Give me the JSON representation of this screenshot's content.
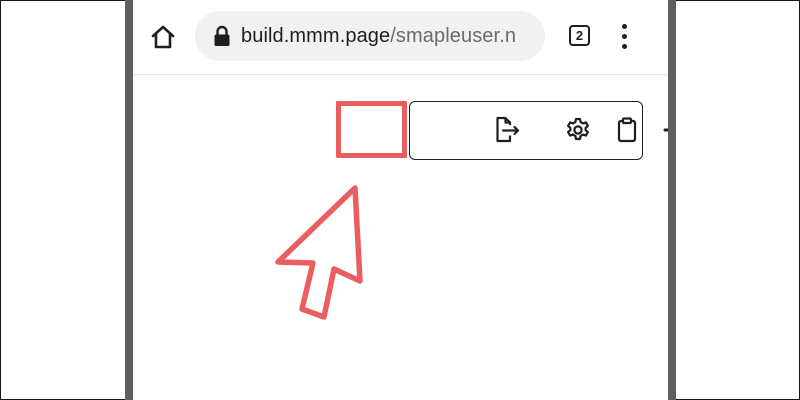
{
  "browser": {
    "url_host": "build.mmm.page",
    "url_path": "/smapleuser.n",
    "tab_count": "2"
  },
  "icons": {
    "home": "home-icon",
    "lock": "lock-icon",
    "menu": "more-vert-icon",
    "export": "file-export-icon",
    "settings": "gear-icon",
    "clipboard": "clipboard-icon",
    "add": "plus-icon",
    "logout": "logout-icon"
  },
  "colors": {
    "highlight": "#ec5d60",
    "bezel": "#5f5f5f",
    "url_bar_bg": "#f0f1f3",
    "icon": "#1f1f1f"
  }
}
